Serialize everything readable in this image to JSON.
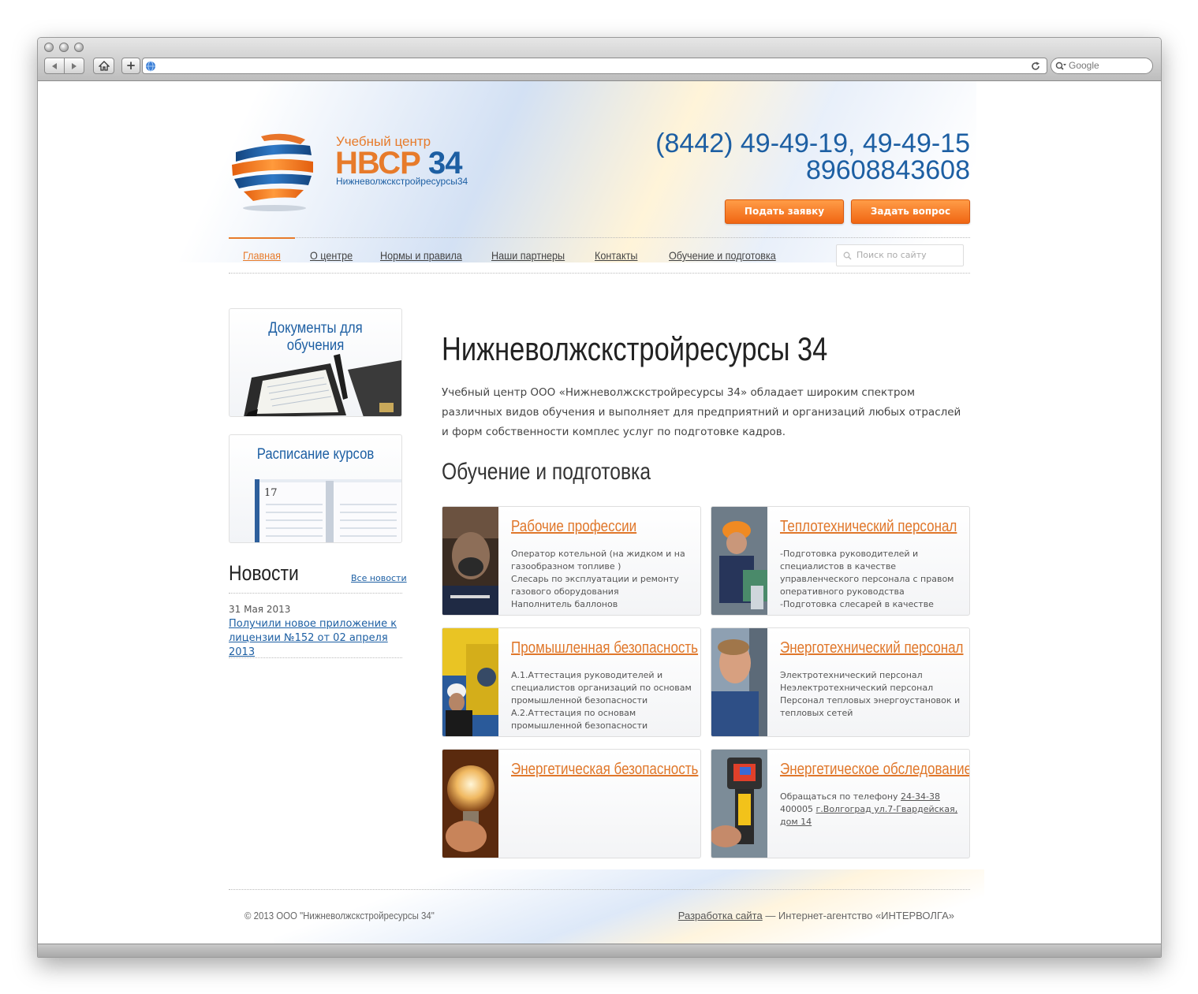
{
  "browser": {
    "search_placeholder": "Google",
    "add_tab_label": "+"
  },
  "header": {
    "logo_small": "Учебный центр",
    "logo_big_letters": "НВСР",
    "logo_big_number": "34",
    "logo_sub": "Нижневолжскстройресурсы34",
    "phone_line1": "(8442) 49-49-19, 49-49-15",
    "phone_line2": "89608843608",
    "btn_apply": "Подать заявку",
    "btn_question": "Задать вопрос"
  },
  "nav": {
    "items": [
      {
        "label": "Главная",
        "active": true
      },
      {
        "label": "О центре"
      },
      {
        "label": "Нормы и правила"
      },
      {
        "label": "Наши партнеры"
      },
      {
        "label": "Контакты"
      },
      {
        "label": "Обучение и подготовка"
      }
    ],
    "search_placeholder": "Поиск по сайту"
  },
  "sidebar": {
    "box1_title": "Документы для обучения",
    "box2_title": "Расписание курсов",
    "box2_day": "17",
    "news_title": "Новости",
    "news_all": "Все новости",
    "news_date": "31 Мая 2013",
    "news_link": "Получили новое приложение к лицензии №152 от 02 апреля 2013"
  },
  "main": {
    "title": "Нижневолжскстройресурсы 34",
    "intro": "Учебный центр ООО «Нижневолжскстройресурсы 34» обладает широким спектром различных видов обучения и выполняет для предприятний и организаций любых отраслей и форм собственности комплес услуг по подготовке кадров.",
    "section_title": "Обучение и подготовка",
    "cards": [
      {
        "title": "Рабочие профессии",
        "lines": [
          "Оператор котельной (на жидком  и на",
          "газообразном топливе )",
          "Слесарь по эксплуатации и ремонту",
          "газового оборудования",
          "Наполнитель баллонов"
        ]
      },
      {
        "title": "Теплотехнический персонал",
        "lines": [
          "-Подготовка руководителей и",
          "специалистов в качестве",
          "управленческого персонала с правом",
          "оперативного руководства",
          "-Подготовка слесарей в качестве"
        ]
      },
      {
        "title": "Промышленная безопасность",
        "lines": [
          "А.1.Аттестация руководителей и",
          "специалистов организаций по основам",
          "промышленной безопасности",
          "А.2.Аттестация по основам",
          "промышленной безопасности"
        ]
      },
      {
        "title": "Энерготехнический персонал",
        "lines": [
          "Электротехнический персонал",
          "Неэлектротехнический персонал",
          "Персонал тепловых энергоустановок и",
          "тепловых сетей"
        ]
      },
      {
        "title": "Энергетическая безопасность",
        "lines": []
      },
      {
        "title": "Энергетическое обследование",
        "line1_prefix": "Обращаться по телефону ",
        "line1_phone": "24-34-38",
        "line2_prefix": "400005 ",
        "line2_addr": "г.Волгоград ул.7-Гвардейская,",
        "line3_addr": "дом 14"
      }
    ]
  },
  "footer": {
    "copyright": "© 2013 ООО \"Нижневолжскстройресурсы 34\"",
    "dev_link": "Разработка сайта",
    "dev_text": " — Интернет-агентство «ИНТЕРВОЛГА»"
  },
  "colors": {
    "brand_blue": "#1d5fa3",
    "brand_orange": "#e77b2b",
    "button_orange": "#f06613"
  }
}
